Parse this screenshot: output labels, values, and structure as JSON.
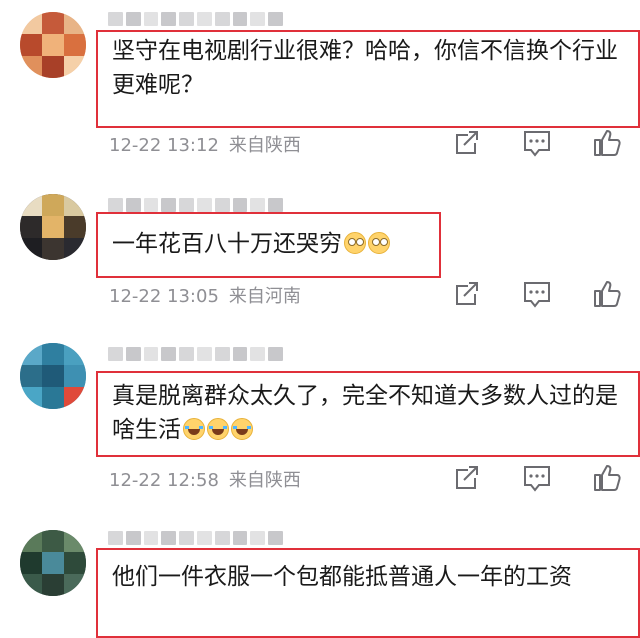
{
  "comments": [
    {
      "username": "",
      "text": "坚守在电视剧行业很难？哈哈，你信不信换个行业更难呢？",
      "emojis": [],
      "time": "12-22 13:12",
      "location": "来自陕西"
    },
    {
      "username": "",
      "text": "一年花百八十万还哭穷",
      "emojis": [
        "eye-roll-emoji",
        "eye-roll-emoji"
      ],
      "time": "12-22 13:05",
      "location": "来自河南"
    },
    {
      "username": "",
      "text": "真是脱离群众太久了，完全不知道大多数人过的是啥生活",
      "emojis": [
        "laugh-cry-emoji",
        "laugh-cry-emoji",
        "laugh-cry-emoji"
      ],
      "time": "12-22 12:58",
      "location": "来自陕西"
    },
    {
      "username": "",
      "text": "他们一件衣服一个包都能抵普通人一年的工资",
      "emojis": [],
      "time": "",
      "location": ""
    }
  ],
  "icons": {
    "share": "share-icon",
    "comment": "comment-icon",
    "like": "like-icon"
  },
  "colors": {
    "highlight_border": "#e0303a",
    "meta_text": "#8f8f94",
    "icon": "#6b6b70"
  }
}
